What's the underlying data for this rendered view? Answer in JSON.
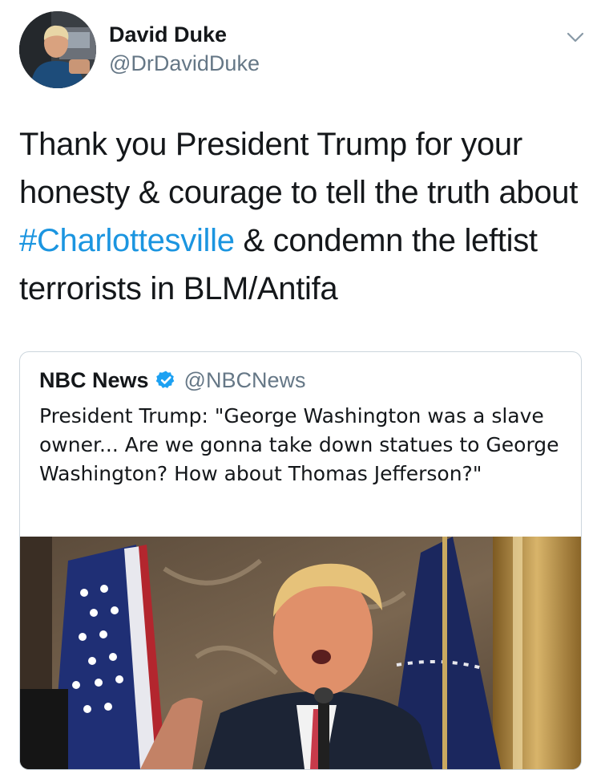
{
  "tweet": {
    "author": {
      "name": "David Duke",
      "handle": "@DrDavidDuke"
    },
    "text_before_hashtag": "Thank you President Trump for your honesty & courage to tell the truth about ",
    "hashtag": "#Charlottesville",
    "text_after_hashtag": " & condemn the leftist terrorists in BLM/Antifa"
  },
  "quoted_tweet": {
    "author": {
      "name": "NBC News",
      "handle": "@NBCNews",
      "verified": true
    },
    "text": "President Trump: \"George Washington was a slave owner... Are we gonna take down statues to George Washington? How about Thomas Jefferson?\""
  },
  "icons": {
    "menu": "chevron-down-icon",
    "verified": "verified-badge-icon"
  },
  "colors": {
    "text": "#14171a",
    "secondary": "#657786",
    "link": "#1b95e0",
    "verified": "#1da1f2",
    "border": "#ccd6dd"
  }
}
